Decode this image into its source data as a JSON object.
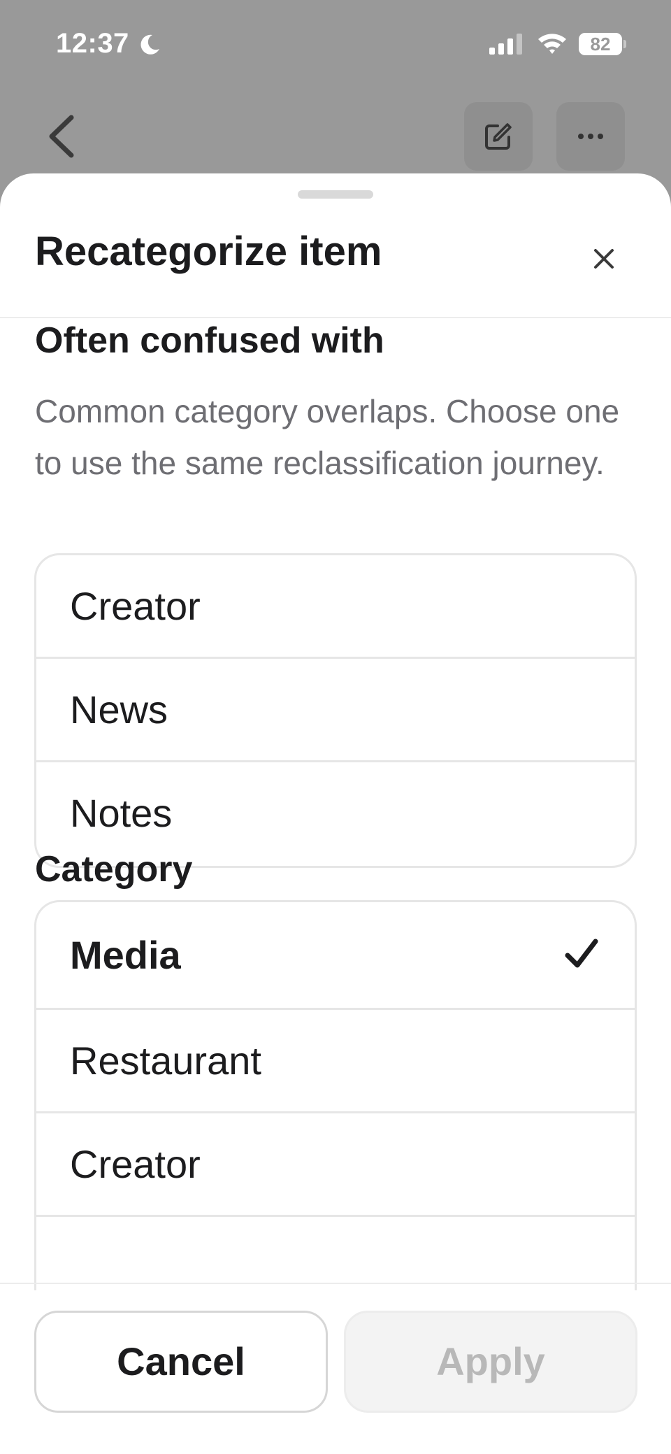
{
  "status_bar": {
    "time": "12:37",
    "battery": "82"
  },
  "colors": {
    "backdrop": "#999999",
    "sheet": "#ffffff",
    "secondary_text": "#6e6e73",
    "disabled_text": "#b8b8b8"
  },
  "sheet": {
    "title": "Recategorize item",
    "close_icon": "close-icon"
  },
  "often_confused": {
    "title": "Often confused with",
    "description": "Common category overlaps. Choose one to use the same reclassification journey.",
    "items": [
      {
        "label": "Creator"
      },
      {
        "label": "News"
      },
      {
        "label": "Notes"
      }
    ]
  },
  "category": {
    "title": "Category",
    "items": [
      {
        "label": "Media",
        "selected": true
      },
      {
        "label": "Restaurant",
        "selected": false
      },
      {
        "label": "Creator",
        "selected": false
      },
      {
        "label": "",
        "selected": false
      }
    ]
  },
  "footer": {
    "cancel_label": "Cancel",
    "apply_label": "Apply",
    "apply_enabled": false
  }
}
